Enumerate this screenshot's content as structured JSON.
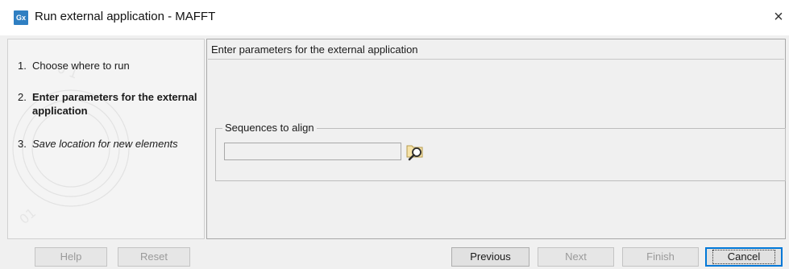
{
  "window": {
    "app_icon_text": "Gx",
    "title": "Run external application - MAFFT",
    "close_glyph": "×"
  },
  "steps": [
    {
      "number": "1.",
      "label": "Choose where to run",
      "state": "normal"
    },
    {
      "number": "2.",
      "label": "Enter parameters for the external application",
      "state": "current"
    },
    {
      "number": "3.",
      "label": "Save location for new elements",
      "state": "pending"
    }
  ],
  "main": {
    "header": "Enter parameters for the external application",
    "group_title": "Sequences to align",
    "input_value": "",
    "browse_icon": "browse-magnifier-icon"
  },
  "buttons": {
    "help": "Help",
    "reset": "Reset",
    "previous": "Previous",
    "next": "Next",
    "finish": "Finish",
    "cancel": "Cancel"
  },
  "colors": {
    "accent": "#0078d7",
    "app_icon": "#2f7fc2",
    "panel_bg": "#f0f0f0"
  }
}
